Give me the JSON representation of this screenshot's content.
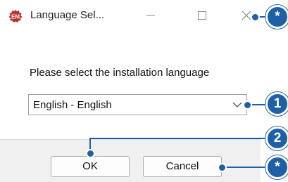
{
  "window": {
    "title": "Language Sel...",
    "icon": "installer-app-icon",
    "controls": [
      "minimize-icon",
      "maximize-icon",
      "close-icon"
    ]
  },
  "body": {
    "prompt": "Please select the installation language"
  },
  "language_select": {
    "value": "English - English"
  },
  "buttons": {
    "ok": "OK",
    "cancel": "Cancel"
  },
  "callouts": {
    "close": "*",
    "language": "1",
    "ok": "2",
    "cancel": "*"
  },
  "colors": {
    "callout": "#1f5fa8",
    "app_icon": "#b8332b"
  }
}
